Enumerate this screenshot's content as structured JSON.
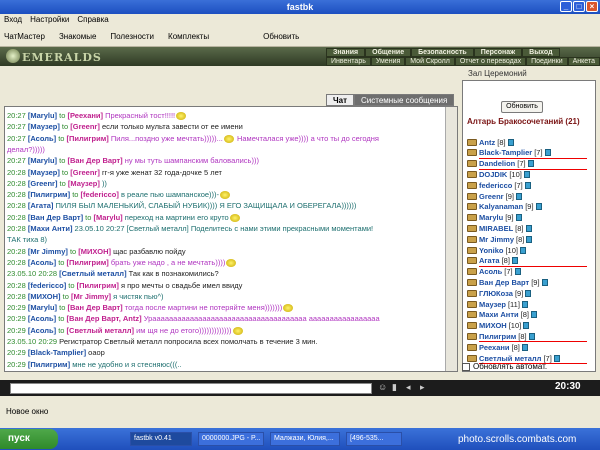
{
  "window": {
    "title": "fastbk",
    "buttons": [
      "_",
      "□",
      "×"
    ]
  },
  "menu": [
    "Вход",
    "Настройки",
    "Справка"
  ],
  "toolbar": [
    "ЧатМастер",
    "Знакомые",
    "Полезности",
    "Комплекты"
  ],
  "toolbar_refresh": "Обновить",
  "banner": {
    "logo": "EMERALDS",
    "nav_top": [
      "Знания",
      "Общение",
      "Безопасность",
      "Персонаж",
      "Выход"
    ],
    "nav_bottom": [
      "Инвентарь",
      "Умения",
      "Мой Скролл",
      "Отчет о переводах",
      "Поединки",
      "Анкета"
    ]
  },
  "chat_tabs": [
    "Чат",
    "Системные сообщения"
  ],
  "chat": [
    {
      "time": "20:27",
      "nick": "Marylu",
      "to": "Реехани",
      "text": "Прекрасный тост!!!!!",
      "color": "lilac",
      "smile": true
    },
    {
      "time": "20:27",
      "nick": "Маузер",
      "to": "Greenr",
      "text": "если только мульта завести от ее имени",
      "color": "black"
    },
    {
      "time": "20:27",
      "nick": "Асоль",
      "to": "Пилигрим",
      "text": "Пиля...поздно уже мечтать)))))...",
      "color": "lilac",
      "tail": "Намечталася уже)))) а что ты до сегодня",
      "smile": true
    },
    {
      "time": "",
      "nick": "",
      "to": "",
      "text": "делал?)))))",
      "color": "lilac"
    },
    {
      "time": "20:27",
      "nick": "Marylu",
      "to": "Ван Дер Варт",
      "text": "ну мы туть шампанским баловались)))",
      "color": "lilac"
    },
    {
      "time": "20:28",
      "nick": "Маузер",
      "to": "Greenr",
      "text": "гг-я уже женат 32 года-дочке 5 лет",
      "color": "black"
    },
    {
      "time": "20:28",
      "nick": "Greenr",
      "to": "Маузер",
      "text": "))",
      "color": "teal"
    },
    {
      "time": "20:28",
      "nick": "Пилигрим",
      "to": "federicco",
      "text": "в реале пью шампанское)))-",
      "color": "teal",
      "smile": true
    },
    {
      "time": "20:28",
      "nick": "Агата",
      "to": "",
      "text": "ПИЛЯ БЫЛ МАЛЕНЬКИЙ, СЛАБЫЙ НУБИК)))) Я ЕГО ЗАЩИЩАЛА И ОБЕРЕГАЛА))))))",
      "color": "teal"
    },
    {
      "time": "20:28",
      "nick": "Ван Дер Варт",
      "to": "Marylu",
      "text": "переход на мартини его круто",
      "color": "teal",
      "smile": true
    },
    {
      "time": "20:28",
      "nick": "Махи Анти",
      "to": "",
      "text": "23.05.10 20:27 [Светлый металл] Поделитесь с нами этими прекрасными моментами!",
      "color": "teal"
    },
    {
      "time": "",
      "nick": "",
      "to": "",
      "text": "ТАК тиха 8)",
      "color": "teal"
    },
    {
      "time": "20:28",
      "nick": "Mr Jimmy",
      "to": "МИХОН",
      "text": "щас разбавлю пойду",
      "color": "black"
    },
    {
      "time": "20:28",
      "nick": "Асоль",
      "to": "Пилигрим",
      "text": "брать уже надо , а не мечтать))))",
      "color": "lilac",
      "smile": true
    },
    {
      "time": "23.05.10 20:28",
      "nick": "Светлый металл",
      "to": "",
      "text": "Так как в познакомились?",
      "color": "black"
    },
    {
      "time": "20:28",
      "nick": "federicco",
      "to": "Пилигрим",
      "text": "я про мечты о свадьбе имел ввиду",
      "color": "black"
    },
    {
      "time": "20:28",
      "nick": "МИХОН",
      "to": "Mr Jimmy",
      "text": "я чистяк пью^)",
      "color": "teal"
    },
    {
      "time": "20:29",
      "nick": "Marylu",
      "to": "Ван Дер Варт",
      "text": "тогда после мартини не потеряйте меня)))))))",
      "color": "lilac",
      "smile": true
    },
    {
      "time": "20:29",
      "nick": "Асоль",
      "to": "Ван Дер Варт, Antz",
      "text": "Урааааааааааааааааааааааааааааааааааааа ааааааааааааааааа",
      "color": "lilac"
    },
    {
      "time": "20:29",
      "nick": "Асоль",
      "to": "Светлый металл",
      "text": "им щя не до етого)))))))))))))",
      "color": "lilac",
      "smile": true
    },
    {
      "time": "23.05.10 20:29",
      "nick": "",
      "to": "",
      "text": "Регистратор Светлый металл попросила всех помолчать в течение 3 мин.",
      "color": "black"
    },
    {
      "time": "20:29",
      "nick": "Black-Tamplier",
      "to": "",
      "text": "оаор",
      "color": "black"
    },
    {
      "time": "20:29",
      "nick": "Пилигрим",
      "to": "",
      "text": "мне не удобно и я стесняюс(((..",
      "color": "teal"
    }
  ],
  "sidebar": {
    "header": "Зал Церемоний",
    "refresh": "Обновить",
    "title": "Алтарь Бракосочетаний",
    "count": "(21)",
    "auto_refresh": "Обновлять автомат.",
    "users": [
      {
        "name": "Antz",
        "level": "[8]",
        "underline": false
      },
      {
        "name": "Black-Tamplier",
        "level": "[7]",
        "underline": true
      },
      {
        "name": "Dandelion",
        "level": "[7]",
        "underline": true
      },
      {
        "name": "DOJDIK",
        "level": "[10]",
        "underline": false
      },
      {
        "name": "federicco",
        "level": "[7]",
        "underline": false
      },
      {
        "name": "Greenr",
        "level": "[9]",
        "underline": false
      },
      {
        "name": "Kalyanaman",
        "level": "[9]",
        "underline": false
      },
      {
        "name": "Marylu",
        "level": "[9]",
        "underline": false
      },
      {
        "name": "MIRABEL",
        "level": "[8]",
        "underline": false
      },
      {
        "name": "Mr Jimmy",
        "level": "[8]",
        "underline": false
      },
      {
        "name": "Yoniko",
        "level": "[10]",
        "underline": false
      },
      {
        "name": "Агата",
        "level": "[8]",
        "underline": true
      },
      {
        "name": "Асоль",
        "level": "[7]",
        "underline": false
      },
      {
        "name": "Ван Дер Варт",
        "level": "[9]",
        "underline": false
      },
      {
        "name": "ГЛЮКоза",
        "level": "[9]",
        "underline": false
      },
      {
        "name": "Маузер",
        "level": "[11]",
        "underline": false
      },
      {
        "name": "Махи Анти",
        "level": "[8]",
        "underline": false
      },
      {
        "name": "МИХОН",
        "level": "[10]",
        "underline": false
      },
      {
        "name": "Пилигрим",
        "level": "[8]",
        "underline": true
      },
      {
        "name": "Реехани",
        "level": "[8]",
        "underline": false
      },
      {
        "name": "Светлый металл",
        "level": "[7]",
        "underline": true
      }
    ]
  },
  "clock": "20:30",
  "status": {
    "newwin": "Новое окно"
  },
  "taskbar": {
    "start": "пуск",
    "tasks": [
      "fastbk v0.41",
      "0000000.JPG - P...",
      "Малжази, Юлия,...",
      "[496-535..."
    ],
    "watermark": "photo.scrolls.combats.com"
  }
}
